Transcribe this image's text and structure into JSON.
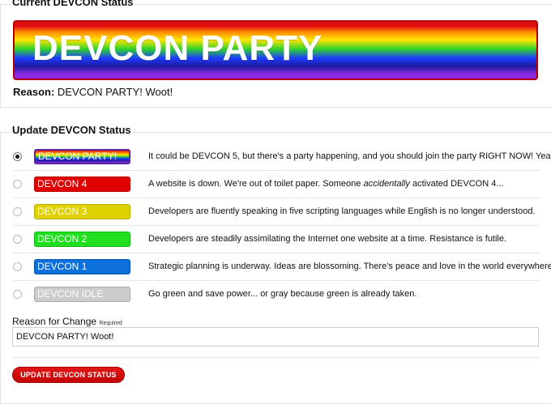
{
  "current": {
    "legend": "Current DEVCON Status",
    "banner": "DEVCON PARTY",
    "reason_label": "Reason:",
    "reason_value": "DEVCON PARTY! Woot!"
  },
  "update": {
    "legend": "Update DEVCON Status",
    "options": [
      {
        "label": "DEVCON PARTY!",
        "selected": true,
        "color": "rainbow",
        "desc": "It could be DEVCON 5, but there's a party happening, and you should join the party RIGHT NOW! Yeahh!"
      },
      {
        "label": "DEVCON 4",
        "selected": false,
        "color": "#e00000",
        "desc_pre": "A website is down. We're out of toilet paper. Someone ",
        "desc_em": "accidentally",
        "desc_post": " activated DEVCON 4..."
      },
      {
        "label": "DEVCON 3",
        "selected": false,
        "color": "#dfd200",
        "desc": "Developers are fluently speaking in five scripting languages while English is no longer understood."
      },
      {
        "label": "DEVCON 2",
        "selected": false,
        "color": "#1fe01f",
        "desc": "Developers are steadily assimilating the Internet one website at a time. Resistance is futile."
      },
      {
        "label": "DEVCON 1",
        "selected": false,
        "color": "#0b6fdc",
        "desc": "Strategic planning is underway. Ideas are blossoming. There's peace and love in the world everywhere."
      },
      {
        "label": "DEVCON IDLE",
        "selected": false,
        "color": "#cccccc",
        "desc": "Go green and save power... or gray because green is already taken."
      }
    ],
    "reason_field_label": "Reason for Change",
    "reason_required": "Required",
    "reason_value": "DEVCON PARTY! Woot!",
    "submit_label": "UPDATE DEVCON STATUS"
  }
}
